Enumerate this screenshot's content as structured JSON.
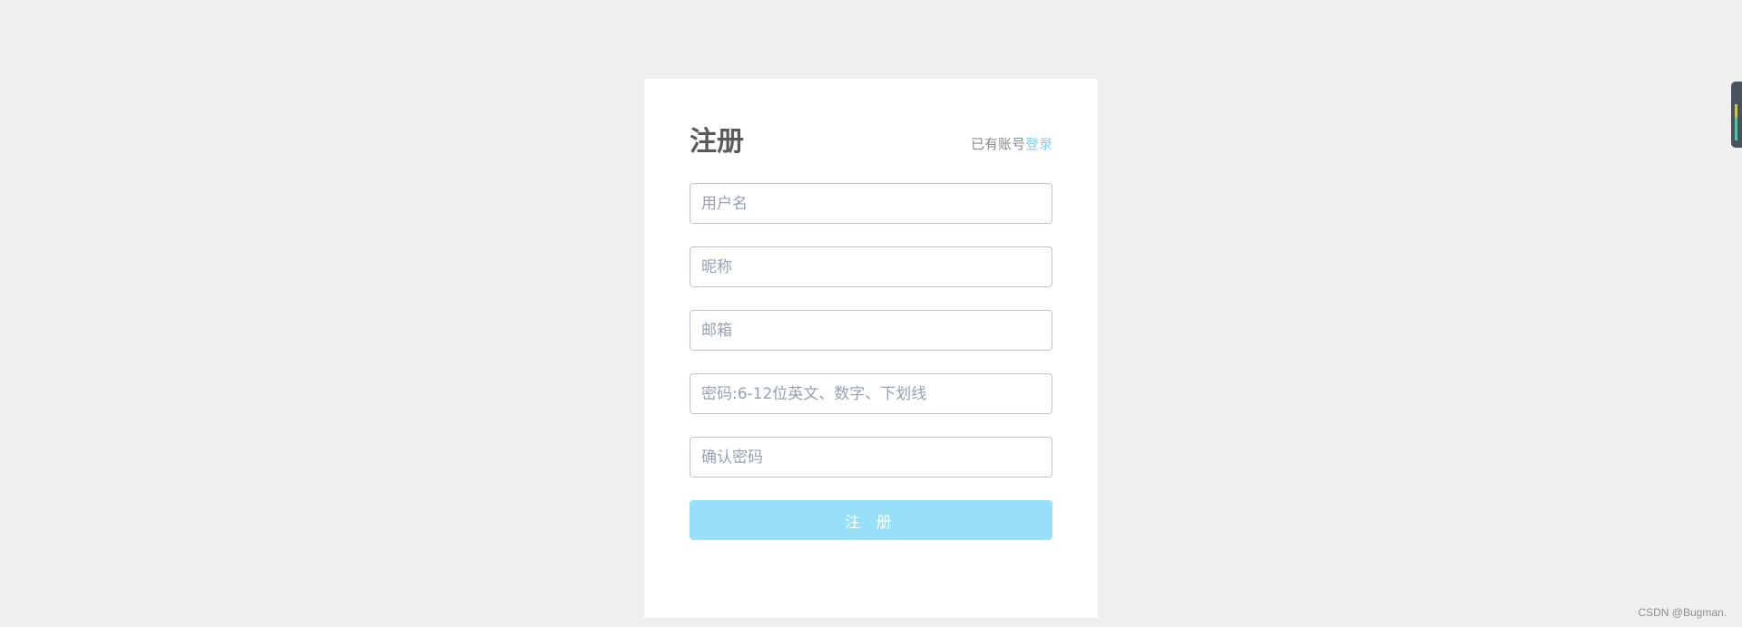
{
  "register": {
    "title": "注册",
    "login_prompt": "已有账号",
    "login_link": "登录",
    "fields": {
      "username": {
        "placeholder": "用户名",
        "value": ""
      },
      "nickname": {
        "placeholder": "昵称",
        "value": ""
      },
      "email": {
        "placeholder": "邮箱",
        "value": ""
      },
      "password": {
        "placeholder": "密码:6-12位英文、数字、下划线",
        "value": ""
      },
      "confirm_password": {
        "placeholder": "确认密码",
        "value": ""
      }
    },
    "submit_label": "注 册"
  },
  "colors": {
    "page_background": "#efefef",
    "card_background": "#ffffff",
    "title": "#5a5a5a",
    "link": "#7fd3f7",
    "button_background": "#98dff9",
    "input_border": "#bfc3cf",
    "placeholder": "#97a2b1"
  },
  "widget": {
    "icon": "volume-meter-icon"
  },
  "watermark": "CSDN @Bugman."
}
